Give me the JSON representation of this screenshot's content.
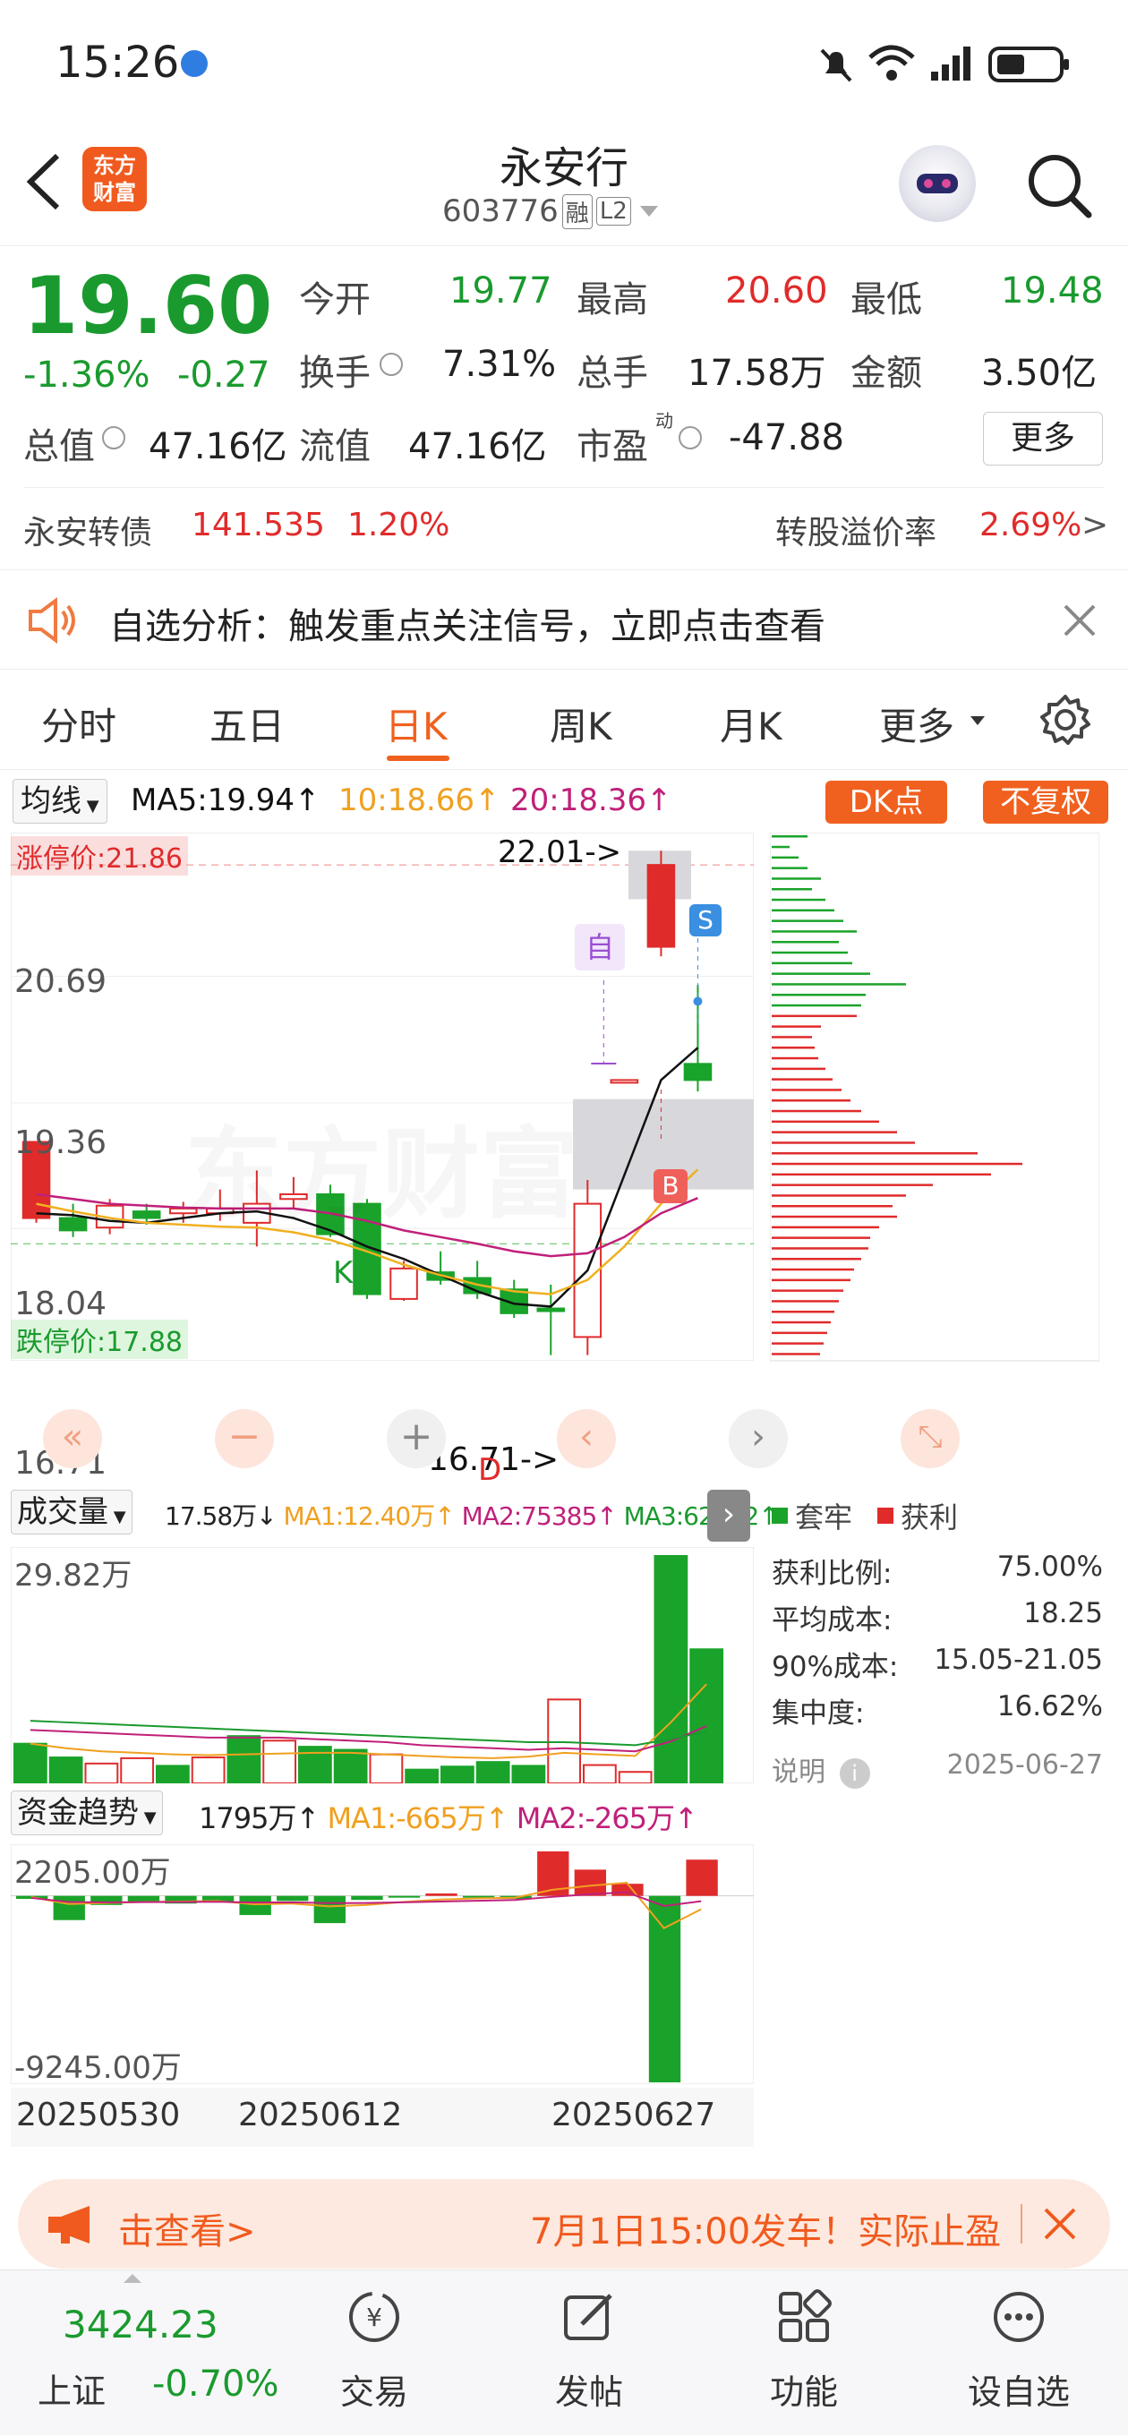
{
  "status_bar": {
    "time": "15:26"
  },
  "header": {
    "title": "永安行",
    "code": "603776",
    "tag_rong": "融",
    "tag_l2": "L2",
    "logo_text_line1": "东方",
    "logo_text_line2": "财富"
  },
  "quote": {
    "price": "19.60",
    "change_pct": "-1.36%",
    "change_abs": "-0.27",
    "open_label": "今开",
    "open_value": "19.77",
    "high_label": "最高",
    "high_value": "20.60",
    "low_label": "最低",
    "low_value": "19.48",
    "turnover_label": "换手",
    "turnover_value": "7.31%",
    "volume_label": "总手",
    "volume_value": "17.58万",
    "amount_label": "金额",
    "amount_value": "3.50亿",
    "mktcap_label": "总值",
    "mktcap_value": "47.16亿",
    "float_label": "流值",
    "float_value": "47.16亿",
    "pe_label": "市盈",
    "pe_sup": "动",
    "pe_value": "-47.88",
    "more_button": "更多",
    "bond_name": "永安转债",
    "bond_price": "141.535",
    "bond_pct": "1.20%",
    "premium_label": "转股溢价率",
    "premium_value": "2.69%",
    "premium_arrow": ">"
  },
  "notice": {
    "text": "自选分析：触发重点关注信号，立即点击查看"
  },
  "tabs": {
    "items": [
      "分时",
      "五日",
      "日K",
      "周K",
      "月K",
      "更多"
    ],
    "active_index": 2
  },
  "kline": {
    "ma_selector": "均线",
    "ma5": "MA5:19.94↑",
    "ma10": "10:18.66↑",
    "ma20": "20:18.36↑",
    "dk_button": "DK点",
    "fuquan_button": "不复权",
    "limit_up_label": "涨停价:21.86",
    "limit_down_label": "跌停价:17.88",
    "high_marker": "22.01->",
    "low_marker": "16.71->",
    "y_labels": [
      "20.69",
      "19.36",
      "18.04",
      "16.71"
    ],
    "marker_zi": "自",
    "marker_s": "S",
    "marker_b": "B",
    "marker_k": "K",
    "marker_d": "D",
    "watermark": "东方财富",
    "colors": {
      "up": "#e02b2b",
      "down": "#1aa32a",
      "ma5": "#111111",
      "ma10": "#f0b020",
      "ma20": "#c0207a"
    },
    "candles": [
      {
        "o": 18.95,
        "c": 18.15,
        "h": 18.95,
        "l": 18.1,
        "up": true
      },
      {
        "o": 18.15,
        "c": 18.02,
        "h": 18.3,
        "l": 17.95,
        "up": false
      },
      {
        "o": 18.05,
        "c": 18.28,
        "h": 18.35,
        "l": 17.98,
        "up": true
      },
      {
        "o": 18.22,
        "c": 18.15,
        "h": 18.3,
        "l": 18.08,
        "up": false
      },
      {
        "o": 18.2,
        "c": 18.25,
        "h": 18.32,
        "l": 18.1,
        "up": true
      },
      {
        "o": 18.25,
        "c": 18.2,
        "h": 18.45,
        "l": 18.12,
        "up": true
      },
      {
        "o": 18.1,
        "c": 18.3,
        "h": 18.65,
        "l": 17.85,
        "up": true
      },
      {
        "o": 18.35,
        "c": 18.4,
        "h": 18.58,
        "l": 18.25,
        "up": true
      },
      {
        "o": 18.4,
        "c": 17.98,
        "h": 18.5,
        "l": 17.95,
        "up": false
      },
      {
        "o": 18.3,
        "c": 17.35,
        "h": 18.35,
        "l": 17.3,
        "up": false
      },
      {
        "o": 17.3,
        "c": 17.62,
        "h": 17.7,
        "l": 17.28,
        "up": true
      },
      {
        "o": 17.58,
        "c": 17.5,
        "h": 17.8,
        "l": 17.45,
        "up": false
      },
      {
        "o": 17.52,
        "c": 17.36,
        "h": 17.7,
        "l": 17.3,
        "up": false
      },
      {
        "o": 17.4,
        "c": 17.15,
        "h": 17.5,
        "l": 17.1,
        "up": false
      },
      {
        "o": 17.2,
        "c": 17.2,
        "h": 17.45,
        "l": 16.71,
        "up": false
      },
      {
        "o": 16.9,
        "c": 18.3,
        "h": 18.55,
        "l": 16.71,
        "up": true
      },
      {
        "o": 19.6,
        "c": 19.6,
        "h": 19.6,
        "l": 19.6,
        "up": true
      },
      {
        "o": 21.0,
        "c": 21.86,
        "h": 22.01,
        "l": 20.9,
        "up": true
      },
      {
        "o": 19.77,
        "c": 19.6,
        "h": 20.6,
        "l": 19.48,
        "up": false
      }
    ],
    "ma5_line": [
      18.2,
      18.18,
      18.12,
      18.1,
      18.15,
      18.2,
      18.22,
      18.15,
      18.02,
      17.85,
      17.72,
      17.55,
      17.38,
      17.25,
      17.22,
      17.6,
      18.6,
      19.6,
      19.94
    ],
    "ma10_line": [
      18.3,
      18.22,
      18.15,
      18.1,
      18.08,
      18.06,
      18.05,
      18.0,
      17.92,
      17.8,
      17.66,
      17.55,
      17.45,
      17.38,
      17.35,
      17.5,
      17.85,
      18.3,
      18.66
    ],
    "ma20_line": [
      18.4,
      18.35,
      18.3,
      18.28,
      18.26,
      18.25,
      18.25,
      18.25,
      18.2,
      18.12,
      18.02,
      17.95,
      17.88,
      17.8,
      17.75,
      17.78,
      17.95,
      18.2,
      18.36
    ],
    "chip_label_trap": "套牢",
    "chip_label_profit": "获利",
    "chip_stats": [
      {
        "label": "获利比例:",
        "value": "75.00%"
      },
      {
        "label": "平均成本:",
        "value": "18.25"
      },
      {
        "label": "90%成本:",
        "value": "15.05-21.05"
      },
      {
        "label": "集中度:",
        "value": "16.62%"
      }
    ],
    "chip_note_label": "说明",
    "chip_date": "2025-06-27"
  },
  "volume": {
    "selector": "成交量",
    "current": "17.58万↓",
    "ma1": "MA1:12.40万↑",
    "ma2": "MA2:75385↑",
    "ma3": "MA3:62952↑",
    "max_label": "29.82万",
    "max_value": 298200,
    "bars": [
      {
        "v": 52000,
        "up": false
      },
      {
        "v": 34000,
        "up": false
      },
      {
        "v": 26000,
        "up": true
      },
      {
        "v": 33000,
        "up": true
      },
      {
        "v": 23000,
        "up": false
      },
      {
        "v": 34000,
        "up": true
      },
      {
        "v": 62000,
        "up": false
      },
      {
        "v": 56000,
        "up": true
      },
      {
        "v": 48000,
        "up": false
      },
      {
        "v": 44000,
        "up": false
      },
      {
        "v": 38000,
        "up": true
      },
      {
        "v": 18000,
        "up": false
      },
      {
        "v": 22000,
        "up": false
      },
      {
        "v": 28000,
        "up": false
      },
      {
        "v": 23000,
        "up": false
      },
      {
        "v": 110000,
        "up": true
      },
      {
        "v": 24000,
        "up": true
      },
      {
        "v": 15000,
        "up": true
      },
      {
        "v": 298200,
        "up": false
      },
      {
        "v": 175800,
        "up": false
      }
    ]
  },
  "fund": {
    "selector": "资金趋势",
    "current": "1795万↑",
    "ma1": "MA1:-665万↑",
    "ma2": "MA2:-265万↑",
    "top_label": "2205.00万",
    "bottom_label": "-9245.00万",
    "max": 2205,
    "min": -9245,
    "bars": [
      -150,
      -1200,
      -450,
      -300,
      -380,
      -300,
      -950,
      -250,
      -1350,
      -200,
      -80,
      120,
      -80,
      -150,
      2205,
      1300,
      600,
      -9245,
      1795
    ]
  },
  "dates": [
    "20250530",
    "20250612",
    "20250627"
  ],
  "banner": {
    "left_text": "击查看>",
    "right_text": "7月1日15:00发车！实际止盈"
  },
  "bottom_nav": {
    "index_value": "3424.23",
    "index_name": "上证",
    "index_change": "-0.70%",
    "items": [
      "交易",
      "发帖",
      "功能",
      "设自选"
    ]
  }
}
